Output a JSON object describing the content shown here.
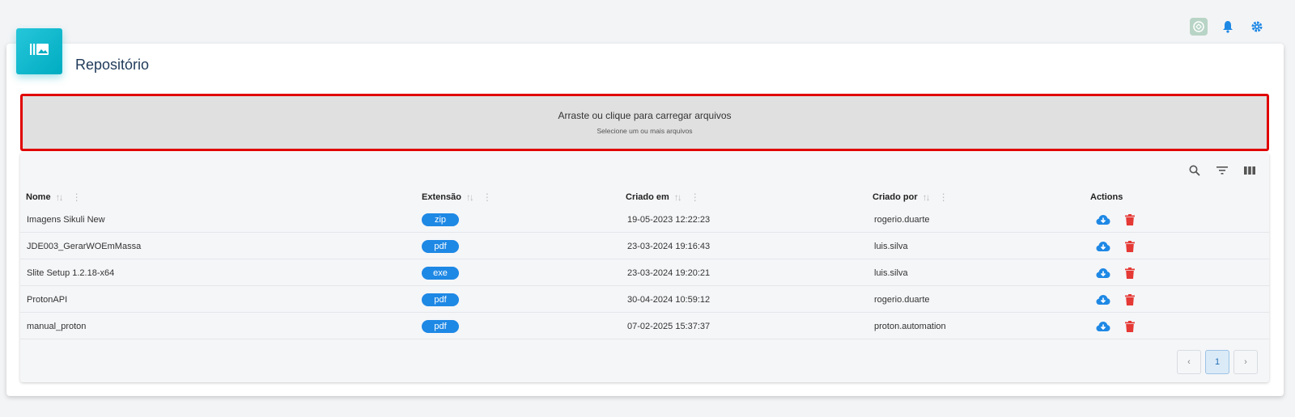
{
  "header": {
    "icons": [
      "chatgpt-icon",
      "bell-icon",
      "gear-icon"
    ],
    "accent_color": "#1e88e5"
  },
  "page": {
    "title": "Repositório",
    "badge_icon": "photo-library-icon"
  },
  "dropzone": {
    "main_text": "Arraste ou clique para carregar arquivos",
    "sub_text": "Selecione um ou mais arquivos",
    "border_color": "#e00000"
  },
  "toolbar": {
    "icons": [
      "search-icon",
      "filter-icon",
      "columns-icon"
    ]
  },
  "table": {
    "columns": [
      {
        "label": "Nome"
      },
      {
        "label": "Extensão"
      },
      {
        "label": "Criado em"
      },
      {
        "label": "Criado por"
      },
      {
        "label": "Actions"
      }
    ],
    "rows": [
      {
        "name": "Imagens Sikuli New",
        "ext": "zip",
        "created_at": "19-05-2023 12:22:23",
        "created_by": "rogerio.duarte"
      },
      {
        "name": "JDE003_GerarWOEmMassa",
        "ext": "pdf",
        "created_at": "23-03-2024 19:16:43",
        "created_by": "luis.silva"
      },
      {
        "name": "Slite Setup 1.2.18-x64",
        "ext": "exe",
        "created_at": "23-03-2024 19:20:21",
        "created_by": "luis.silva"
      },
      {
        "name": "ProtonAPI",
        "ext": "pdf",
        "created_at": "30-04-2024 10:59:12",
        "created_by": "rogerio.duarte"
      },
      {
        "name": "manual_proton",
        "ext": "pdf",
        "created_at": "07-02-2025 15:37:37",
        "created_by": "proton.automation"
      }
    ]
  },
  "pagination": {
    "prev": "‹",
    "current": "1",
    "next": "›"
  }
}
